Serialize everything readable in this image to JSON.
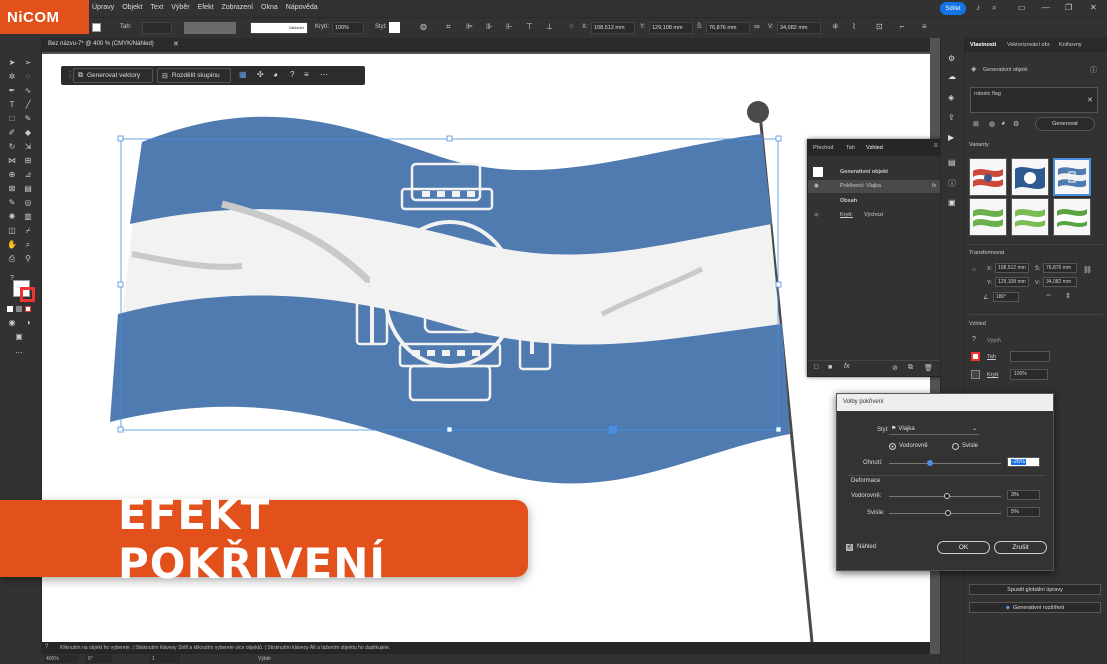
{
  "logo": {
    "text": "NiCOM"
  },
  "menu": [
    "Úpravy",
    "Objekt",
    "Text",
    "Výběr",
    "Efekt",
    "Zobrazení",
    "Okna",
    "Nápověda"
  ],
  "topbar": {
    "share_label": "Sdílet"
  },
  "control_bar": {
    "stroke_label": "Tah:",
    "stroke_profile": "Základní",
    "opacity_label": "Krytí:",
    "opacity_value": "100%",
    "style_label": "Styl:",
    "x_label": "X:",
    "x_value": "108,512 mm",
    "y_label": "Y:",
    "y_value": "129,108 mm",
    "w_label": "Š:",
    "w_value": "76,876 mm",
    "h_label": "V:",
    "h_value": "34,082 mm"
  },
  "document": {
    "tab_title": "Bez názvu-7* @ 400 % (CMYK/Náhled)"
  },
  "context_bar": {
    "generate_vectors": "Generovat vektory",
    "ungroup": "Rozdělit skupinu"
  },
  "properties": {
    "tabs": [
      "Vlastnosti",
      "Vektorizování obr.",
      "Knihovny"
    ],
    "gen_object_label": "Generativní objekt",
    "prompt": "robotic flag",
    "generate_button": "Generovat",
    "variants_label": "Varianty",
    "transform_label": "Transformovat",
    "x_label": "X:",
    "x_value": "108,512 mm",
    "y_label": "Y:",
    "y_value": "129,108 mm",
    "w_label": "Š:",
    "w_value": "76,876 mm",
    "h_label": "V:",
    "h_value": "34,082 mm",
    "angle_value": "180°",
    "appearance_label": "Vzhled",
    "fill_label": "Výplň",
    "stroke_label": "Tah",
    "opacity_label": "Krytí",
    "opacity_value": "100%",
    "global_edit_button": "Spustit globální úpravy",
    "gen_expand_button": "Generativní rozšíření"
  },
  "appearance_panel": {
    "tabs": [
      "Přechod",
      "Tah",
      "Vzhled"
    ],
    "rows": [
      {
        "label": "Generativní objekt",
        "value": ""
      },
      {
        "label": "Pokřivení: Vlajka",
        "value": "fx"
      },
      {
        "label": "Obsah",
        "value": ""
      },
      {
        "label": "Krytí:",
        "value": "Výchozí"
      }
    ]
  },
  "warp_dialog": {
    "title": "Volby pokřivení",
    "style_label": "Styl:",
    "style_value": "Vlajka",
    "horizontal_label": "Vodorovně",
    "vertical_label": "Svisle",
    "bend_label": "Ohnutí:",
    "bend_value": "-26%",
    "distortion_label": "Deformace",
    "dist_h_label": "Vodorovně:",
    "dist_h_value": "3%",
    "dist_v_label": "Svisle:",
    "dist_v_value": "5%",
    "preview_label": "Náhled",
    "ok_label": "OK",
    "cancel_label": "Zrušit",
    "bend_fraction": 0.37,
    "dist_h_fraction": 0.515,
    "dist_v_fraction": 0.525
  },
  "status": {
    "text": "Kliknutím na objekt ho vyberete.  |  Stisknutím klávesy Shift a kliknutím vyberete více objektů.  |  Stisknutím klávesy Alt a tažením objektu ho duplikujete.",
    "zoom": "400%",
    "angle": "0°",
    "page": "1",
    "mode": "Výběr"
  },
  "banner": {
    "text": "EFEKT POKŘIVENÍ"
  },
  "colors": {
    "accent": "#e2501c",
    "flag_blue": "#4f7bb0",
    "flag_white": "#f4f4f4",
    "share_blue": "#1473e6"
  }
}
